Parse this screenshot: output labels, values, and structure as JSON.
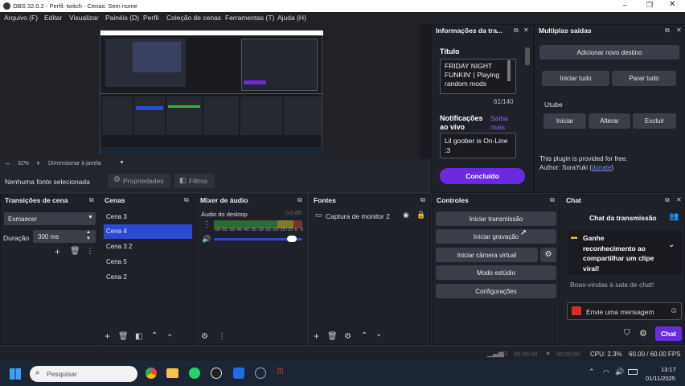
{
  "window": {
    "title": "OBS 32.0.2 - Perfil: twitch - Cenas: Sem nome"
  },
  "menu": [
    "Arquivo (F)",
    "Editar",
    "Visualizar",
    "Painéis (D)",
    "Perfil",
    "Coleção de cenas",
    "Ferramentas (T)",
    "Ajuda (H)"
  ],
  "preview": {
    "zoom": "32%",
    "resize_label": "Dimensionar à janela",
    "no_source": "Nenhuma fonte selecionada",
    "properties": "Propriedades",
    "filters": "Filtros"
  },
  "info_dock": {
    "title": "Informações da tra...",
    "title_label": "Título",
    "title_value": "FRIDAY NIGHT FUNKIN' | Playing random mods",
    "counter": "61/140",
    "notif_label": "Notificações ao vivo",
    "learn_more": "Saiba mais",
    "notif_value": "Lil goober is On-Line :3",
    "done": "Concluído"
  },
  "multi_output": {
    "title": "Multiplas saídas",
    "add": "Adicionar novo destino",
    "start_all": "Iniciar tudo",
    "stop_all": "Parar tudo",
    "target_name": "Utube",
    "start": "Iniciar",
    "edit": "Alterar",
    "delete": "Excluir",
    "plugin_note": "This plugin is provided for free.",
    "author_prefix": "Author: SoraYuki (",
    "donate": "donate",
    "author_suffix": ")"
  },
  "transitions": {
    "title": "Transições de cena",
    "type": "Esmaecer",
    "duration_label": "Duração",
    "duration_value": "300 ms"
  },
  "scenes": {
    "title": "Cenas",
    "items": [
      "Cena 3",
      "Cena 4",
      "Cena 3 2",
      "Cena 5",
      "Cena 2"
    ]
  },
  "mixer": {
    "title": "Mixer de áudio",
    "channel": "Áudio do desktop",
    "level": "0.0 dB",
    "ticks": [
      "-60",
      "-55",
      "-50",
      "-45",
      "-40",
      "-35",
      "-30",
      "-25",
      "-20",
      "-15",
      "-10",
      "-5",
      "0"
    ],
    "volume_fraction": 0.93
  },
  "sources": {
    "title": "Fontes",
    "items": [
      "Captura de monitor 2"
    ]
  },
  "controls": {
    "title": "Controles",
    "start_stream": "Iniciar transmissão",
    "start_record": "Iniciar gravação",
    "virtual_cam": "Iniciar câmera virtual",
    "studio_mode": "Modo estúdio",
    "settings": "Configurações"
  },
  "chat": {
    "title": "Chat",
    "heading": "Chat da transmissão",
    "promo": "Ganhe reconhecimento ao compartilhar um clipe viral!",
    "welcome": "Boas-vindas à sala de chat!",
    "input_placeholder": "Envie uma mensagem",
    "send": "Chat"
  },
  "status": {
    "stream_time": "00:00:00",
    "rec_time": "00:00:00",
    "cpu": "CPU: 2.3%",
    "fps": "60.00 / 60.00 FPS"
  },
  "taskbar": {
    "search": "Pesquisar",
    "time": "13:17",
    "date": "01/11/2025"
  },
  "colors": {
    "accent": "#2c4bd4",
    "done_button": "#6a2be0",
    "link": "#9a5cff",
    "taskbar": "#1c2533"
  }
}
